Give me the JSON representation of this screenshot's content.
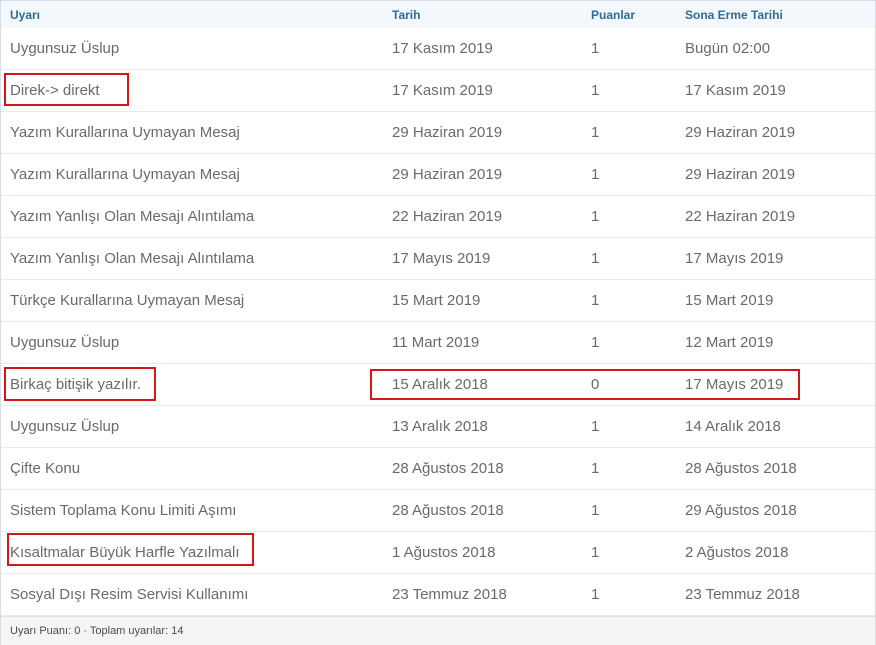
{
  "columns": [
    "Uyarı",
    "Tarih",
    "Puanlar",
    "Sona Erme Tarihi"
  ],
  "rows": [
    {
      "uyari": "Uygunsuz Üslup",
      "tarih": "17 Kasım 2019",
      "puan": "1",
      "sona_erme": "Bugün 02:00"
    },
    {
      "uyari": "Direk-> direkt",
      "tarih": "17 Kasım 2019",
      "puan": "1",
      "sona_erme": "17 Kasım 2019"
    },
    {
      "uyari": "Yazım Kurallarına Uymayan Mesaj",
      "tarih": "29 Haziran 2019",
      "puan": "1",
      "sona_erme": "29 Haziran 2019"
    },
    {
      "uyari": "Yazım Kurallarına Uymayan Mesaj",
      "tarih": "29 Haziran 2019",
      "puan": "1",
      "sona_erme": "29 Haziran 2019"
    },
    {
      "uyari": "Yazım Yanlışı Olan Mesajı Alıntılama",
      "tarih": "22 Haziran 2019",
      "puan": "1",
      "sona_erme": "22 Haziran 2019"
    },
    {
      "uyari": "Yazım Yanlışı Olan Mesajı Alıntılama",
      "tarih": "17 Mayıs 2019",
      "puan": "1",
      "sona_erme": "17 Mayıs 2019"
    },
    {
      "uyari": "Türkçe Kurallarına Uymayan Mesaj",
      "tarih": "15 Mart 2019",
      "puan": "1",
      "sona_erme": "15 Mart 2019"
    },
    {
      "uyari": "Uygunsuz Üslup",
      "tarih": "11 Mart 2019",
      "puan": "1",
      "sona_erme": "12 Mart 2019"
    },
    {
      "uyari": "Birkaç bitişik yazılır.",
      "tarih": "15 Aralık 2018",
      "puan": "0",
      "sona_erme": "17 Mayıs 2019"
    },
    {
      "uyari": "Uygunsuz Üslup",
      "tarih": "13 Aralık 2018",
      "puan": "1",
      "sona_erme": "14 Aralık 2018"
    },
    {
      "uyari": "Çifte Konu",
      "tarih": "28 Ağustos 2018",
      "puan": "1",
      "sona_erme": "28 Ağustos 2018"
    },
    {
      "uyari": "Sistem Toplama Konu Limiti Aşımı",
      "tarih": "28 Ağustos 2018",
      "puan": "1",
      "sona_erme": "29 Ağustos 2018"
    },
    {
      "uyari": "Kısaltmalar Büyük Harfle Yazılmalı",
      "tarih": "1 Ağustos 2018",
      "puan": "1",
      "sona_erme": "2 Ağustos 2018"
    },
    {
      "uyari": "Sosyal Dışı Resim Servisi Kullanımı",
      "tarih": "23 Temmuz 2018",
      "puan": "1",
      "sona_erme": "23 Temmuz 2018"
    }
  ],
  "footer": {
    "text": "Uyarı Puanı: 0 · Toplam uyarılar: 14"
  },
  "colors": {
    "header_text": "#2f6b98",
    "header_bg": "#f3f8fd",
    "cell_text": "#6a6a6a",
    "highlight": "#d01818"
  }
}
